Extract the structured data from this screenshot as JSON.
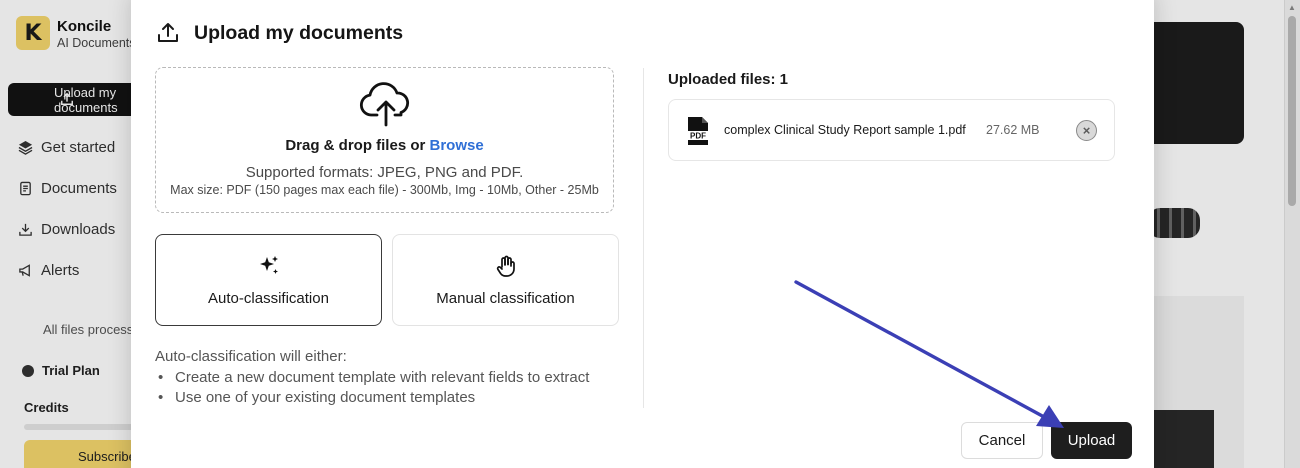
{
  "background": {
    "logo_letter": "K",
    "brand_name": "Koncile",
    "brand_subtitle": "AI Documents",
    "upload_button_label": "Upload my documents",
    "nav": [
      {
        "label": "Get started",
        "icon": "stack-icon"
      },
      {
        "label": "Documents",
        "icon": "document-icon"
      },
      {
        "label": "Downloads",
        "icon": "download-icon"
      },
      {
        "label": "Alerts",
        "icon": "megaphone-icon"
      }
    ],
    "note": "All files processed",
    "plan_label": "Trial Plan",
    "credits_label": "Credits",
    "subscribe_label": "Subscribe"
  },
  "modal": {
    "title": "Upload my documents",
    "dropzone": {
      "drag_text": "Drag & drop files or ",
      "browse_link": "Browse",
      "formats": "Supported formats: JPEG, PNG and PDF.",
      "max_size": "Max size: PDF (150 pages max each file) - 300Mb, Img - 10Mb, Other - 25Mb"
    },
    "classification": {
      "auto_label": "Auto-classification",
      "manual_label": "Manual classification",
      "selected": "Auto-classification"
    },
    "auto_description": {
      "intro": "Auto-classification will either:",
      "items": [
        "Create a new document template with relevant fields to extract",
        "Use one of your existing document templates"
      ]
    },
    "uploaded": {
      "title": "Uploaded files: 1",
      "files": [
        {
          "name": "complex Clinical Study Report sample 1.pdf",
          "size": "27.62 MB",
          "type_badge": "PDF"
        }
      ]
    },
    "buttons": {
      "cancel": "Cancel",
      "upload": "Upload"
    }
  },
  "colors": {
    "accent_link": "#2f6fd6",
    "primary_button": "#1e1e1e",
    "annotation_arrow": "#3b3fb5",
    "brand_yellow": "#f5d76e"
  }
}
